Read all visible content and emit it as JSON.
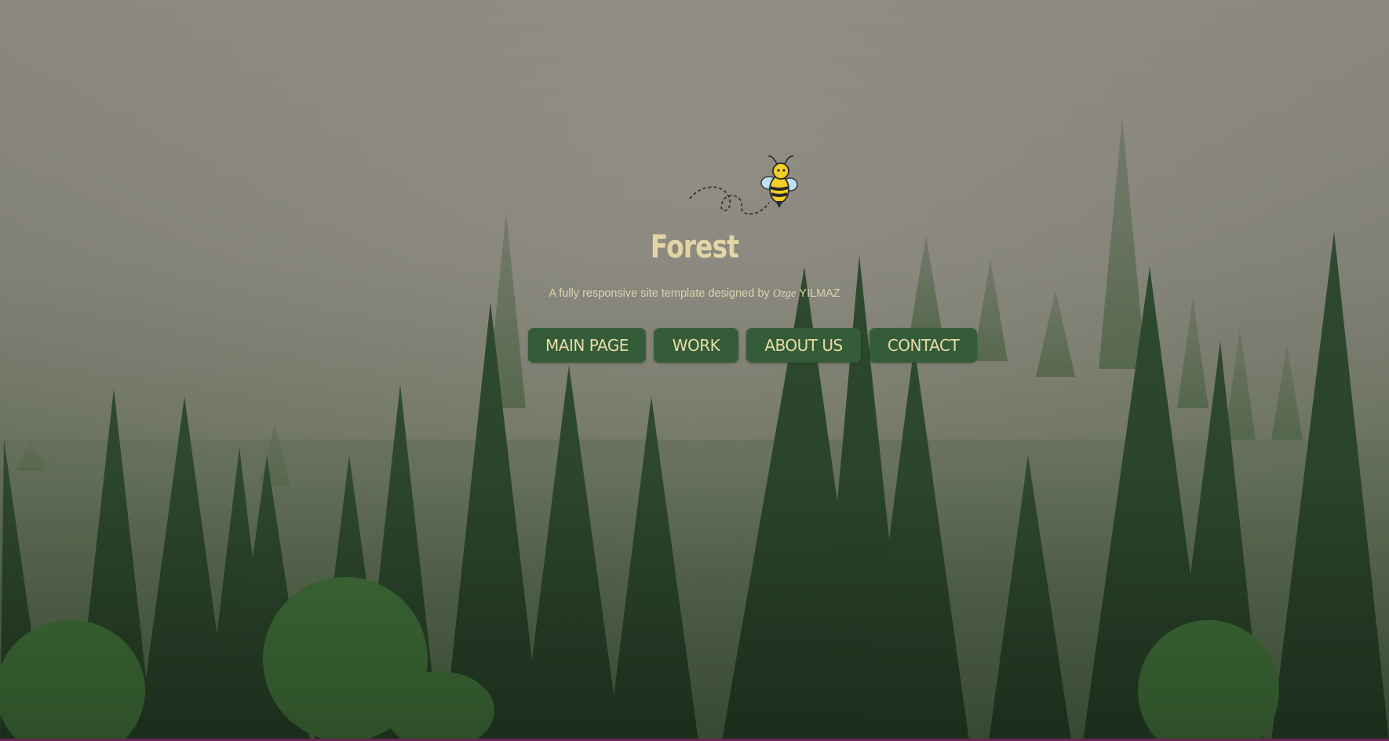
{
  "hero": {
    "title": "Forest",
    "subtitle_prefix": "A fully responsive site template designed by ",
    "subtitle_author": "Ozge",
    "subtitle_suffix": " YILMAZ"
  },
  "nav": {
    "items": [
      {
        "label": "MAIN PAGE"
      },
      {
        "label": "WORK"
      },
      {
        "label": "ABOUT US"
      },
      {
        "label": "CONTACT"
      }
    ]
  },
  "colors": {
    "title": "#e3d6a4",
    "button_bg": "#345c38",
    "button_text": "#e7dca8",
    "bottom_bar": "#6d2456"
  },
  "icons": {
    "logo": "bee-icon"
  }
}
